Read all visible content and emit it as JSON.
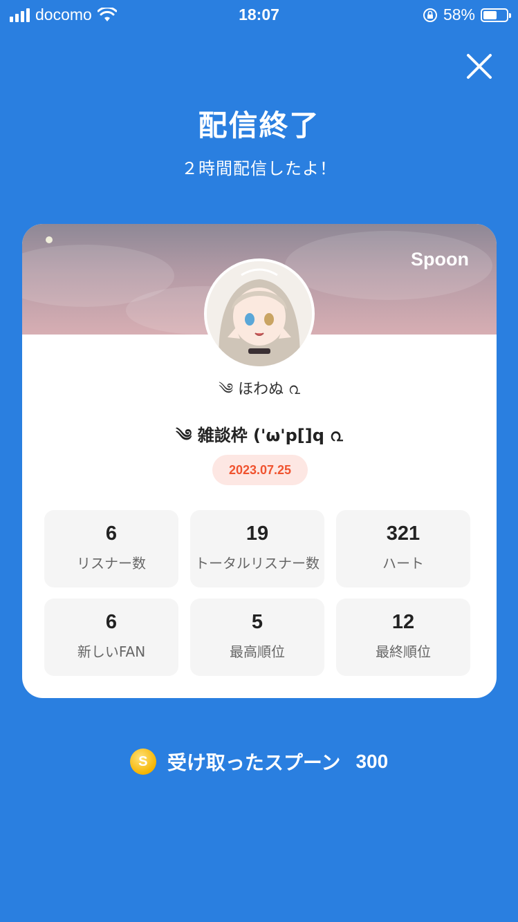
{
  "status_bar": {
    "carrier": "docomo",
    "time": "18:07",
    "battery_percent": "58%",
    "battery_level": 0.58,
    "icons": [
      "signal-icon",
      "wifi-icon",
      "orientation-lock-icon",
      "battery-icon"
    ]
  },
  "header": {
    "close_icon": "close-icon",
    "title": "配信終了",
    "subtitle": "２時間配信したよ！"
  },
  "card": {
    "brand": "Spoon",
    "avatar_icon": "avatar-image",
    "username": "༄ ほわぬ ൨",
    "broadcast_title": "༄ 雑談枠 ('ω'p[]q ൨",
    "date": "2023.07.25",
    "stats": [
      {
        "value": "6",
        "label": "リスナー数"
      },
      {
        "value": "19",
        "label": "トータルリスナー数"
      },
      {
        "value": "321",
        "label": "ハート"
      },
      {
        "value": "6",
        "label": "新しいFAN"
      },
      {
        "value": "5",
        "label": "最高順位"
      },
      {
        "value": "12",
        "label": "最終順位"
      }
    ]
  },
  "footer": {
    "coin_icon": "coin-icon",
    "coin_glyph": "S",
    "spoons_label": "受け取ったスプーン",
    "spoons_value": "300"
  },
  "colors": {
    "background": "#2a7fe0",
    "accent_date": "#f0532f",
    "date_badge_bg": "#fde7e3",
    "stat_bg": "#f5f5f5",
    "coin": "#f5b400"
  }
}
